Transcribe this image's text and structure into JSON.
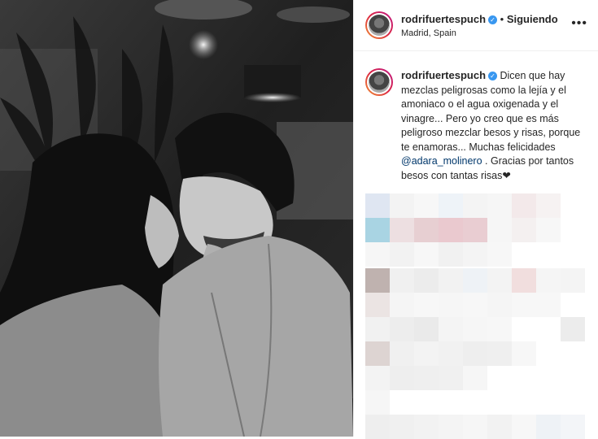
{
  "post": {
    "username": "rodrifuertespuch",
    "follow_status": "Siguiendo",
    "separator": "•",
    "location": "Madrid, Spain",
    "more_label": "•••",
    "caption_user": "rodrifuertespuch",
    "caption_text": "Dicen que hay mezclas peligrosas como la lejía y el amoniaco o el agua oxigenada y el vinagre... Pero yo creo que es más peligroso mezclar besos y risas, porque te enamoras... Muchas felicidades",
    "mention": "@adara_molinero",
    "caption_end": ". Gracias por tantos besos con tantas risas❤"
  },
  "colors": {
    "verified": "#3897f0",
    "mention": "#00376b",
    "text": "#262626"
  },
  "icons": {
    "verified": "verified-badge-icon",
    "more": "more-options-icon"
  }
}
